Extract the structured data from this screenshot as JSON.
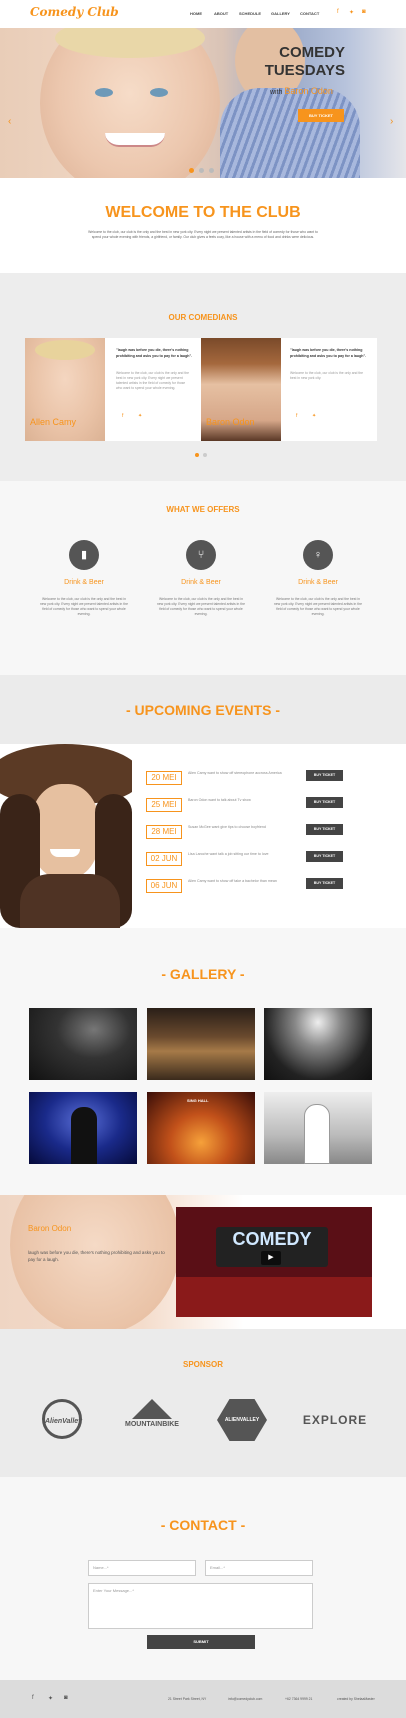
{
  "header": {
    "logo": "Comedy Club",
    "nav": [
      "HOME",
      "ABOUT",
      "SCHEDULE",
      "GALLERY",
      "CONTACT"
    ]
  },
  "colors": {
    "accent": "#f7941d",
    "dark": "#444444",
    "light_bg": "#ededed"
  },
  "hero": {
    "title_line1": "COMEDY",
    "title_line2": "TUESDAYS",
    "sub_prefix": "with",
    "sub_name": "Baron Odon",
    "button": "BUY TICKET",
    "prev": "‹",
    "next": "›"
  },
  "welcome": {
    "title": "WELCOME TO THE CLUB",
    "text": "Welcome to the club, our club is the only and the best in new york city. Every night we present talented artists in the field of comedy for those who want to spend your whole evening with friends, a girlfriend, or family. Our club gives a feels cozy, like a house with a menu of food and drinks were delicious."
  },
  "comedians": {
    "title": "OUR COMEDIANS",
    "items": [
      {
        "name": "Allen Camy",
        "quote": "\"laugh was before you die, there's nothing prohibiting and asks you to pay for a laugh\".",
        "text": "Welcome to the club, our club is the only and the best in new york city. Every night we present talented artists in the field of comedy for those who want to spend your whole evening."
      },
      {
        "name": "Baron Odon",
        "quote": "\"laugh was before you die, there's nothing prohibiting and asks you to pay for a laugh\".",
        "text": "Welcome to the club, our club is the only and the best in new york city."
      }
    ]
  },
  "offers": {
    "title": "WHAT WE OFFERS",
    "items": [
      {
        "icon": "beer-icon",
        "title": "Drink & Beer",
        "text": "Welcome to the club, our club is the only and the best in new york city. Every night we present talented artists in the field of comedy for those who want to spend your whole evening."
      },
      {
        "icon": "food-icon",
        "title": "Drink & Beer",
        "text": "Welcome to the club, our club is the only and the best in new york city. Every night we present talented artists in the field of comedy for those who want to spend your whole evening."
      },
      {
        "icon": "microphone-icon",
        "title": "Drink & Beer",
        "text": "Welcome to the club, our club is the only and the best in new york city. Every night we present talented artists in the field of comedy for those who want to spend your whole evening."
      }
    ]
  },
  "events": {
    "title": "- UPCOMING EVENTS -",
    "items": [
      {
        "date": "20 MEI",
        "text": "Allen Camy want to show off stereophone accross America",
        "button": "BUY TICKET"
      },
      {
        "date": "25 MEI",
        "text": "Baron Odon want to talk about Tv show",
        "button": "BUY TICKET"
      },
      {
        "date": "28 MEI",
        "text": "Susan McGee want give tips to choose boyfriend",
        "button": "BUY TICKET"
      },
      {
        "date": "02 JUN",
        "text": "Lisa Laroche want talk a job sitting our time to love",
        "button": "BUY TICKET"
      },
      {
        "date": "06 JUN",
        "text": "Allen Camy want to show off take a bachelor than mean",
        "button": "BUY TICKET"
      }
    ]
  },
  "gallery": {
    "title": "- GALLERY -",
    "sign": "SING HALL"
  },
  "video": {
    "name": "Baron Odon",
    "text": "laugh was before you die, there's nothing prohibiting and asks you to pay for a laugh.",
    "screen": "COMEDY"
  },
  "sponsor": {
    "title": "SPONSOR",
    "logos": [
      "AlienValley",
      "MOUNTAINBIKE",
      "ALIENVALLEY",
      "EXPLORE"
    ]
  },
  "contact": {
    "title": "- CONTACT -",
    "name_ph": "Name...*",
    "email_ph": "Email...*",
    "msg_ph": "Enter Your Message...*",
    "submit": "SUBMIT"
  },
  "footer": {
    "address": "21 Street Park Street, NY",
    "email": "info@comedyclub.com",
    "phone": "+62 7364 9999 21",
    "credit": "created by ShelaaMaster"
  }
}
